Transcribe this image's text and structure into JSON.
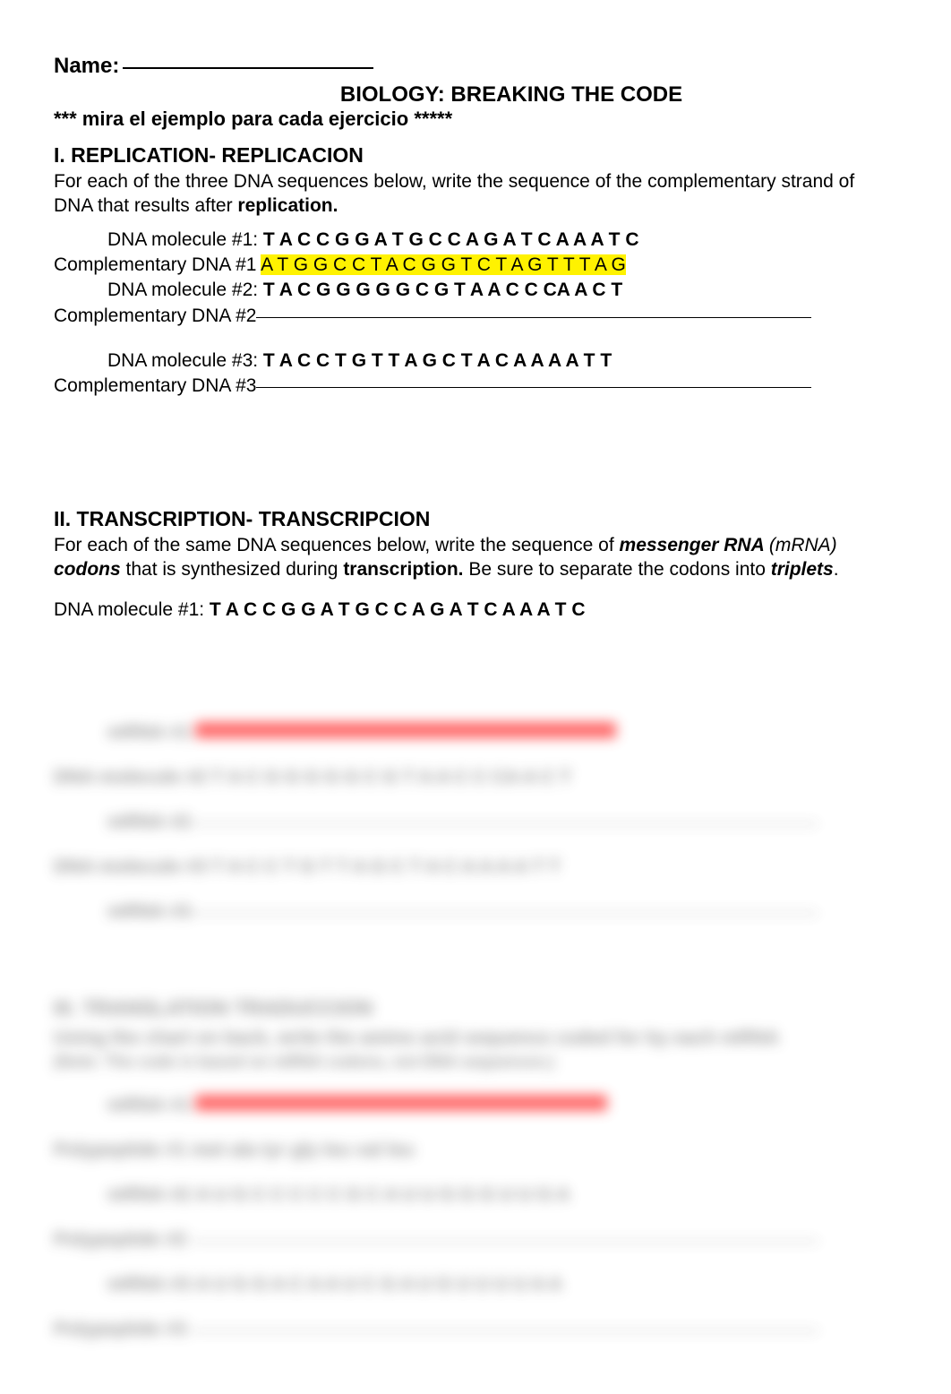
{
  "header": {
    "name_label": "Name:",
    "title": "BIOLOGY: BREAKING THE CODE",
    "subtitle": "*** mira el ejemplo para cada ejercicio *****"
  },
  "section1": {
    "heading": "I. REPLICATION- REPLICACION",
    "intro_part1": "For each of the three DNA sequences below, write the sequence of the complementary strand of DNA that results after ",
    "intro_bold": "replication.",
    "dna1_label": "DNA molecule #1: ",
    "dna1_seq": "T A C C G G A T G C C A G A T C A A A T C",
    "comp1_label": "Complementary DNA #1 ",
    "comp1_seq": "A T G G C C T A C G G T C T A G T T T A G",
    "dna2_label": "DNA molecule #2: ",
    "dna2_seq": "T A C G G G G G C G T A A C C CA A C T",
    "comp2_label": "Complementary DNA #2",
    "dna3_label": "DNA molecule #3: ",
    "dna3_seq": "T A C C T G T T A G C T A C A A A A T T",
    "comp3_label": "Complementary DNA #3"
  },
  "section2": {
    "heading": "II. TRANSCRIPTION- TRANSCRIPCION",
    "intro_part1": "For each of the same DNA sequences below, write the sequence of ",
    "intro_bi1": "messenger RNA ",
    "intro_italic1": "(mRNA) ",
    "intro_bi2": "codons",
    "intro_part2": " that is synthesized during ",
    "intro_bold": "transcription.",
    "intro_part3": " Be sure to separate the codons into ",
    "intro_bi3": "triplets",
    "intro_end": ".",
    "dna1_label": "DNA molecule #1: ",
    "dna1_seq": "T A C C G G A T G C C A G A T C A A A T C"
  },
  "blurred": {
    "mrna_label": "mRNA #1",
    "dna2_placeholder": "DNA molecule #2  T A C G G G G G C G T A A C C  CA  A C T",
    "mrna2_label": "mRNA #2",
    "dna3_placeholder": "DNA molecule #3  T A C C T G T T A G C T A C  A A A A T T",
    "mrna3_label": "mRNA #3",
    "section3_heading": "III. TRANSLATION  TRADUCCION",
    "section3_body": "Using the chart on back, write the amino acid sequence coded for by each mRNA",
    "section3_note": "(Note: The code is based on mRNA codons, not DNA sequences.)",
    "poly_label1": "Polypeptide #1",
    "poly_seq1": "met   ala   tyr    gly    leu    val    leu",
    "poly_label2": "Polypeptide #2",
    "mrna2_seq_placeholder": "A U G C C C C C G C A U U G G G U U G A",
    "poly_label3": "Polypeptide #3",
    "mrna3_seq_placeholder": "A U G G A C A A U C G A U G U U U U A A"
  }
}
